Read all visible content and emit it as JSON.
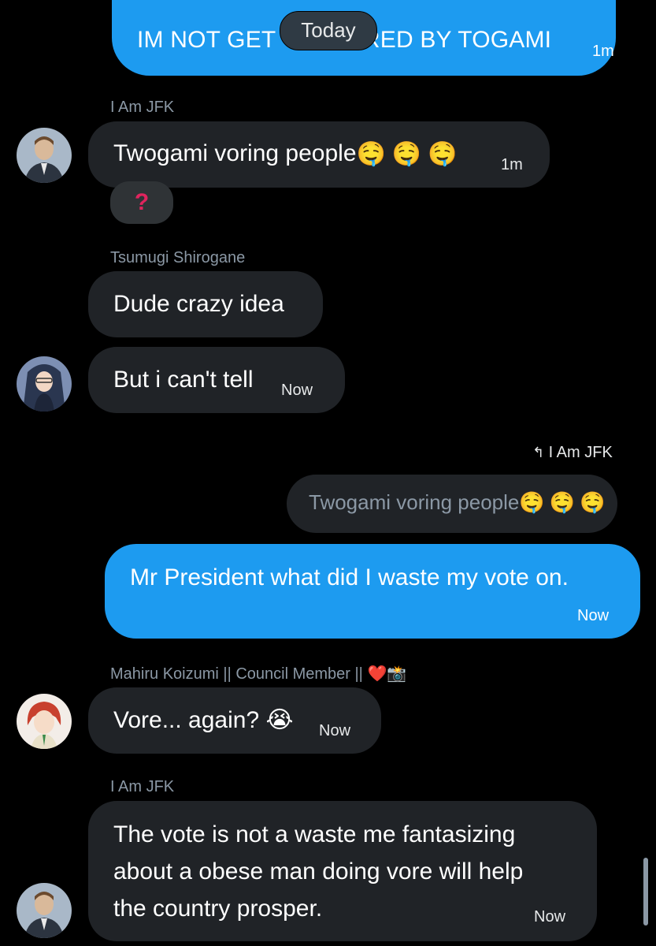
{
  "divider": {
    "label": "Today"
  },
  "messages": [
    {
      "text": "IM NOT GET              ORED BY TOGAMI",
      "time": "1m"
    },
    {
      "sender": "I Am JFK",
      "text": "Twogami voring people",
      "emoji": "🤤🤤🤤",
      "time": "1m",
      "reaction": "?"
    },
    {
      "sender": "Tsumugi Shirogane",
      "text": "Dude crazy idea"
    },
    {
      "text": "But i can't tell",
      "time": "Now"
    },
    {
      "reply_to_label": "I Am JFK",
      "quoted_text": "Twogami voring people",
      "quoted_emoji": "🤤🤤🤤",
      "text": "Mr President what did I waste my vote on.",
      "time": "Now"
    },
    {
      "sender": "Mahiru Koizumi || Council Member ||",
      "sender_emoji": "❤️📸",
      "text": "Vore... again?",
      "emoji": "😭",
      "time": "Now"
    },
    {
      "sender": "I Am JFK",
      "lines": [
        "The vote is not a waste me fantasizing",
        "about a obese man doing vore will help",
        "the country prosper."
      ],
      "time": "Now"
    }
  ],
  "colors": {
    "outgoing": "#1d9bf0",
    "incoming": "#202327",
    "background": "#000000",
    "secondary_text": "#8b98a5",
    "reaction": "#e0245e"
  },
  "icons": {
    "reply": "reply-arrow-icon",
    "reaction": "question-mark-reaction"
  }
}
